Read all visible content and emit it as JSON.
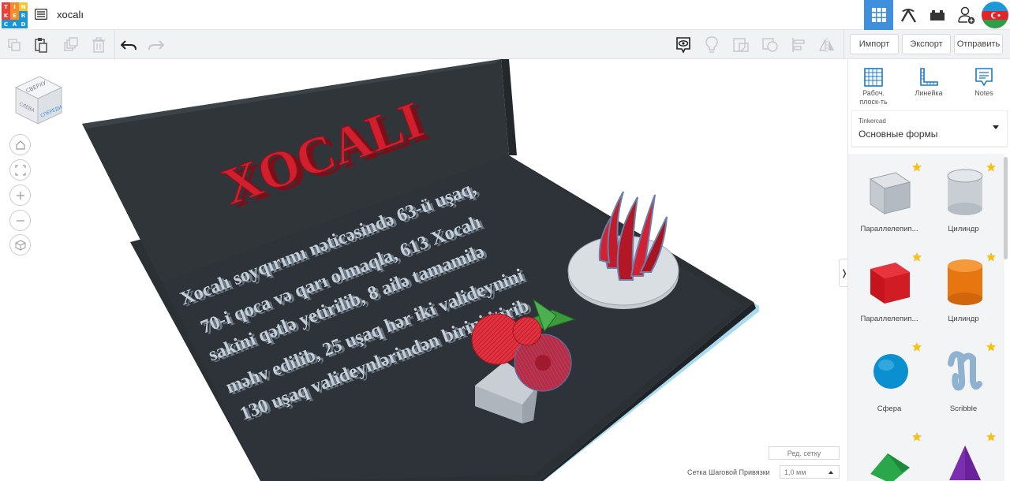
{
  "app": {
    "logo_letters": [
      "T",
      "I",
      "N",
      "K",
      "E",
      "R",
      "C",
      "A",
      "D"
    ],
    "logo_colors": [
      "#e8423b",
      "#f58c2a",
      "#f7c532",
      "#e8423b",
      "#f58c2a",
      "#1a95d6",
      "#1a95d6",
      "#1a95d6",
      "#1a95d6"
    ],
    "title": "xocalı"
  },
  "topbar": {
    "icons": [
      "grid-view-icon",
      "pickaxe-icon",
      "bricks-icon",
      "add-user-icon",
      "avatar-flag-icon"
    ]
  },
  "toolbar": {
    "import_label": "Импорт",
    "export_label": "Экспорт",
    "send_label": "Отправить"
  },
  "viewcube": {
    "top_label": "СВЕРХУ",
    "front_label": "СПЕРЕДИ",
    "left_label": "СЛЕВА"
  },
  "scene": {
    "title_text": "XOCALI",
    "text_lines": [
      "Xocalı soyqırımı nəticəsində 63-ü uşaq,",
      "70-i qoca və qarı olmaqla, 613 Xocalı",
      "sakini qətlə yetirilib, 8 ailə tamamilə",
      "məhv edilib, 25 uşaq hər iki valideynini",
      "130 uşaq valideynlərindən birini itirib"
    ]
  },
  "grid": {
    "edit_label": "Ред. сетку",
    "snap_label": "Сетка Шаговой Привязки",
    "snap_value": "1,0 мм"
  },
  "panel": {
    "tools": [
      {
        "label": "Рабоч. плоск-ть"
      },
      {
        "label": "Линейка"
      },
      {
        "label": "Notes"
      }
    ],
    "library_label": "Tinkercad",
    "library_value": "Основные формы",
    "shapes": [
      {
        "label": "Параллелепип...",
        "color": "#b8bec6"
      },
      {
        "label": "Цилиндр",
        "color": "#c6ccd3"
      },
      {
        "label": "Параллелепип...",
        "color": "#d5161f"
      },
      {
        "label": "Цилиндр",
        "color": "#f07d0f"
      },
      {
        "label": "Сфера",
        "color": "#0a8fd0"
      },
      {
        "label": "Scribble",
        "color": "#8eb2cf"
      },
      {
        "label": "",
        "color": "#2aa74a"
      },
      {
        "label": "",
        "color": "#7b2fb0"
      }
    ]
  },
  "colors": {
    "accent": "#3f8fdf",
    "board": "#2d3338",
    "extruded_text": "#bfcad6",
    "title_red": "#cf1d2c"
  }
}
